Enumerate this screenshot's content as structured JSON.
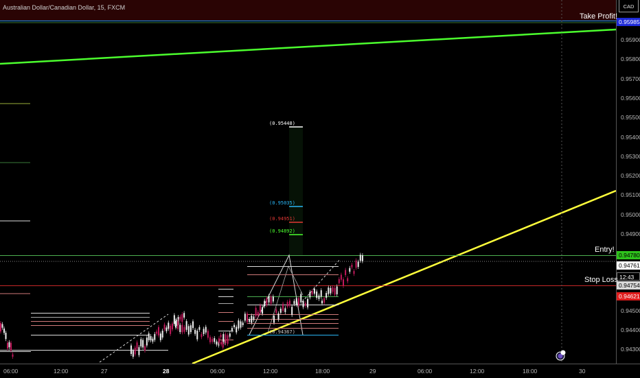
{
  "symbol": "Australian Dollar/Canadian Dollar, 15, FXCM",
  "currency": "CAD",
  "axis_ticks": [
    "0.95985",
    "0.95900",
    "0.95800",
    "0.95700",
    "0.95600",
    "0.95500",
    "0.95400",
    "0.95300",
    "0.95200",
    "0.95100",
    "0.95000",
    "0.94900",
    "0.94780",
    "0.94761",
    "0.94754",
    "0.94621",
    "0.94500",
    "0.94400",
    "0.94300"
  ],
  "price_tags": {
    "take_profit": "0.95985",
    "entry": "0.94780",
    "last": "0.94761",
    "countdown": "12:43",
    "mid": "0.94754",
    "stop_loss": "0.94621"
  },
  "labels": {
    "take_profit": "Take Profit!",
    "entry": "Entry!",
    "stop_loss": "Stop Loss"
  },
  "fib_labels": [
    "(0.95448)",
    "(0.95035)",
    "(0.94951)",
    "(0.94892)",
    "(0.94367)"
  ],
  "time_labels": [
    "06:00",
    "12:00",
    "27",
    "28",
    "06:00",
    "12:00",
    "18:00",
    "29",
    "06:00",
    "12:00",
    "18:00",
    "30"
  ],
  "colors": {
    "take_profit_line": "#2196f3",
    "entry_line": "#4caf50",
    "stop_loss_line": "#c62828",
    "trend_green": "#4cff2e",
    "trend_yellow": "#ffff3b",
    "tp_zone": "#2a0404"
  }
}
